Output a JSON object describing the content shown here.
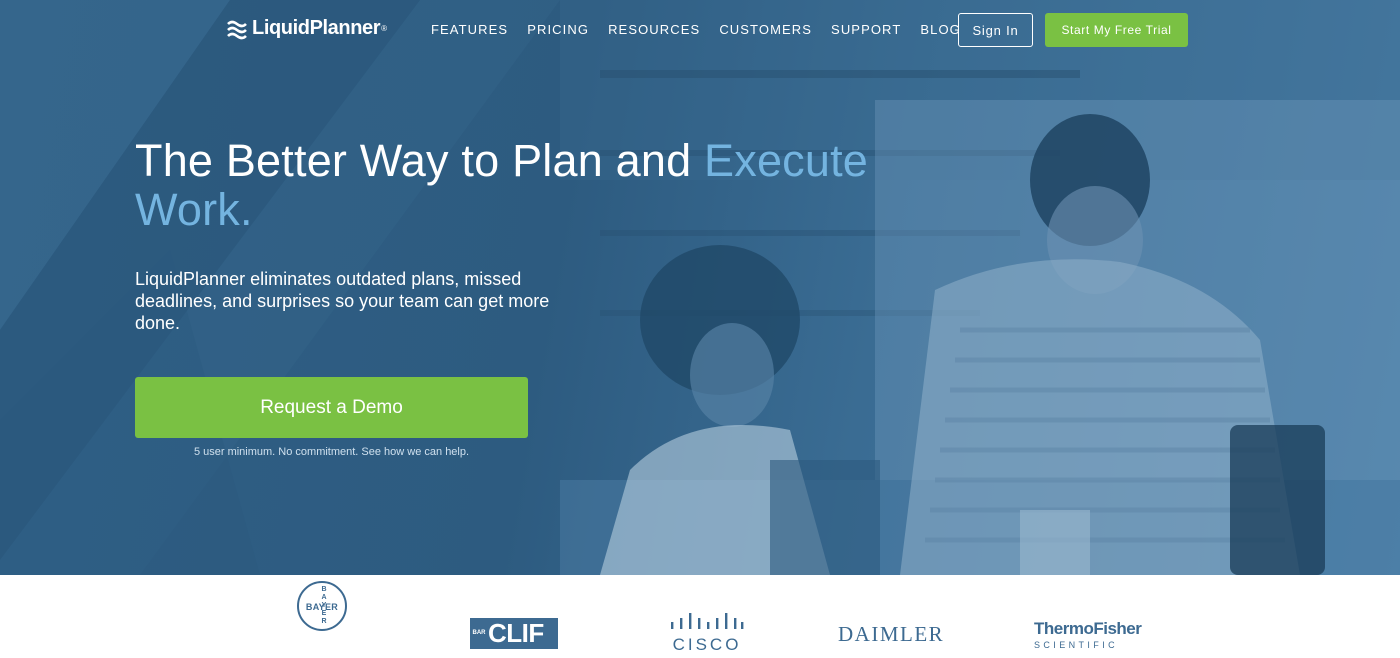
{
  "brand": {
    "logo_text": "LiquidPlanner",
    "logo_reg": "®"
  },
  "nav": {
    "links": [
      {
        "label": "FEATURES"
      },
      {
        "label": "PRICING"
      },
      {
        "label": "RESOURCES"
      },
      {
        "label": "CUSTOMERS"
      },
      {
        "label": "SUPPORT"
      },
      {
        "label": "BLOG"
      }
    ],
    "signin_label": "Sign In",
    "trial_label": "Start My Free Trial"
  },
  "hero": {
    "headline_main": "The Better Way to Plan and",
    "headline_accent": "Execute Work.",
    "subtext": "LiquidPlanner eliminates outdated plans, missed deadlines, and surprises so your team can get more done.",
    "cta_label": "Request a Demo",
    "cta_note": "5 user minimum. No commitment. See how we can help."
  },
  "customer_logos": {
    "bayer_vertical": "B A Y E R",
    "bayer_horizontal": "BAYER",
    "clif_small": "BAR",
    "clif_main": "CLIF",
    "cisco": "CISCO",
    "daimler": "DAIMLER",
    "thermo_main": "ThermoFisher",
    "thermo_sub": "SCIENTIFIC"
  },
  "colors": {
    "hero_blue": "#2f5f85",
    "accent_blue": "#74b4e0",
    "cta_green": "#7ac143",
    "logo_blue": "#3d6a91"
  },
  "icons": {
    "logo_mark": "liquid-waves-icon"
  }
}
